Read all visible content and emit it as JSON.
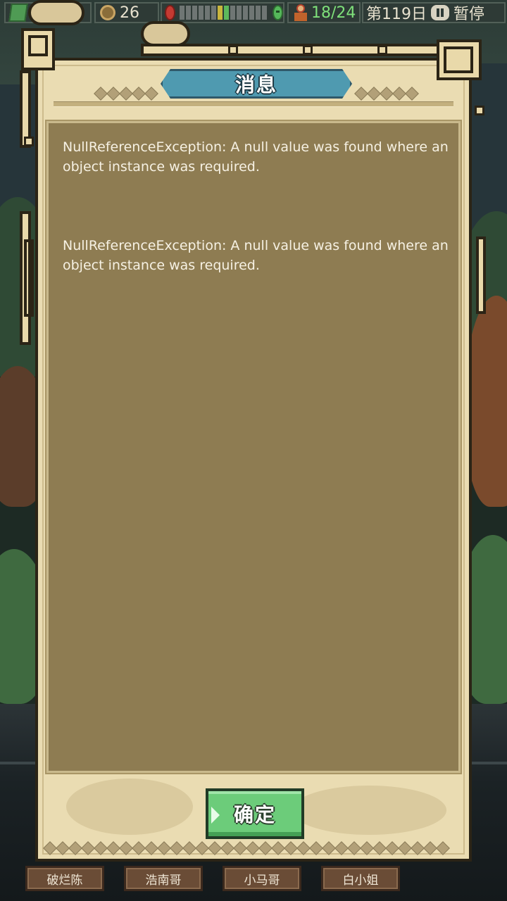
{
  "hud": {
    "coins": "26",
    "mood_segments": [
      "gray",
      "gray",
      "gray",
      "gray",
      "gray",
      "gray",
      "yellow",
      "green",
      "gray",
      "gray",
      "gray",
      "gray",
      "gray",
      "gray"
    ],
    "population": "18/24",
    "day": "第119日",
    "pause_label": "暂停"
  },
  "dialog": {
    "title": "消息",
    "messages": [
      "NullReferenceException: A null value was found where an object instance was required.",
      "NullReferenceException: A null value was found where an object instance was required."
    ],
    "confirm_label": "确定"
  },
  "tabs": [
    "破烂陈",
    "浩南哥",
    "小马哥",
    "白小姐"
  ],
  "colors": {
    "panel": "#8e7c52",
    "frame": "#eadcb2",
    "title_plate": "#4f9ab0",
    "confirm": "#6ccc7a",
    "tab": "#6a4c36"
  }
}
